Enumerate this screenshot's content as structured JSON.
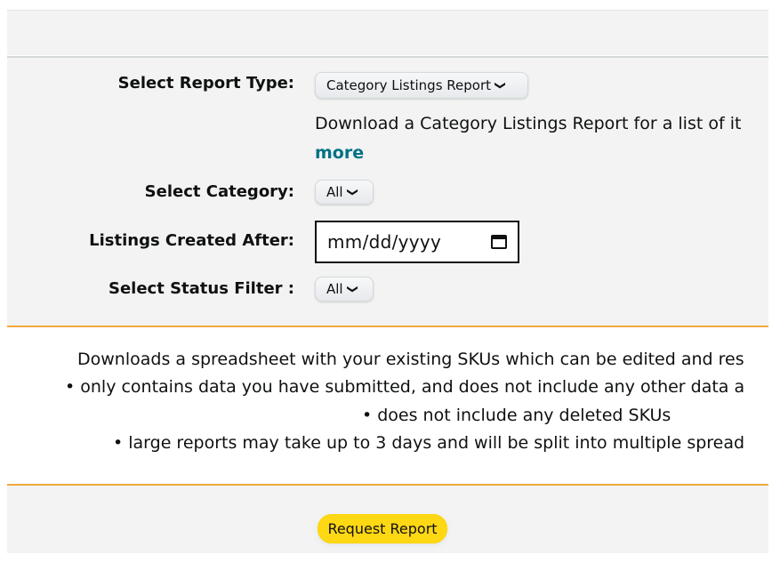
{
  "form": {
    "report_type_label": "Select Report Type:",
    "report_type_value": "Category Listings Report",
    "report_description": "Download a Category Listings Report for a list of it",
    "more_link": "more",
    "category_label": "Select Category:",
    "category_value": "All",
    "created_after_label": "Listings Created After:",
    "created_after_placeholder": "mm/dd/yyyy",
    "status_filter_label": "Select Status Filter :",
    "status_filter_value": "All"
  },
  "info": {
    "line1": "Downloads a spreadsheet with your existing SKUs which can be edited and res",
    "line2": "• only contains data you have submitted, and does not include any other data a",
    "line3": "• does not include any deleted SKUs",
    "line4": "• large reports may take up to 3 days and will be split into multiple spread"
  },
  "actions": {
    "request_report_label": "Request Report"
  },
  "icons": {
    "dropdown": "chevron-down-icon",
    "date_picker": "calendar-icon"
  },
  "colors": {
    "accent_orange": "#f2a93b",
    "button_yellow": "#ffd814",
    "link_teal": "#007185",
    "panel_gray": "#f3f3f3"
  }
}
